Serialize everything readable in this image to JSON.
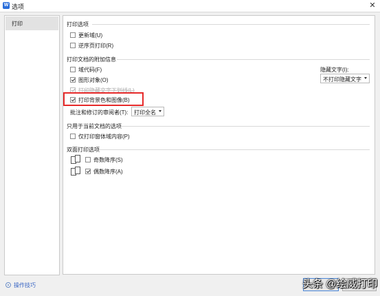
{
  "window": {
    "title": "选项",
    "app_icon_letter": "W"
  },
  "sidebar": {
    "items": [
      {
        "label": "打印",
        "selected": true
      }
    ]
  },
  "print_options": {
    "heading": "打印选项",
    "items": [
      {
        "label": "更新域(U)",
        "checked": false
      },
      {
        "label": "逆序页打印(R)",
        "checked": false
      }
    ]
  },
  "additional_info": {
    "heading": "打印文档的附加信息",
    "items": [
      {
        "label": "域代码(F)",
        "checked": false,
        "disabled": false
      },
      {
        "label": "图形对象(O)",
        "checked": true,
        "disabled": false
      },
      {
        "label": "打印隐藏文字下划线(L)",
        "checked": true,
        "disabled": true
      },
      {
        "label": "打印背景色和图像(B)",
        "checked": true,
        "disabled": false
      }
    ],
    "hidden_text": {
      "label": "隐藏文字(I):",
      "value": "不打印隐藏文字"
    },
    "reviewer": {
      "label": "批注和修订的审阅者(T):",
      "value": "打印全名"
    }
  },
  "current_doc": {
    "heading": "只用于当前文档的选项",
    "items": [
      {
        "label": "仅打印窗体域内容(P)",
        "checked": false
      }
    ]
  },
  "duplex": {
    "heading": "双面打印选项",
    "items": [
      {
        "label": "奇数降序(S)",
        "checked": false,
        "icon": "odd-pages-icon"
      },
      {
        "label": "偶数降序(A)",
        "checked": true,
        "icon": "even-pages-icon"
      }
    ]
  },
  "footer": {
    "tips_label": "操作技巧",
    "watermark": "头条 @绘威打印"
  },
  "colors": {
    "highlight": "#e62a2a",
    "link": "#3a66c4",
    "accent": "#2a6edb"
  }
}
